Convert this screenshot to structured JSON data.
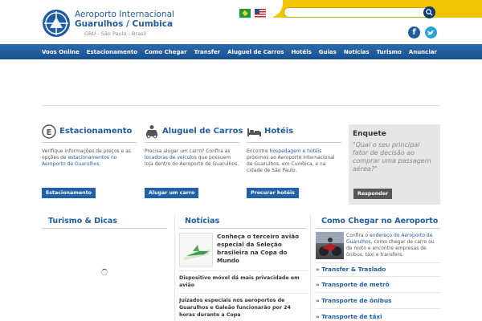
{
  "header": {
    "logo_line1": "Aeroporto Internacional",
    "logo_line2": "Guarulhos / Cumbica",
    "logo_line3": "GRU - São Paulo - Brasil",
    "search_placeholder": "",
    "accent_yellow": "#f1c400",
    "brand_blue": "#1f5da3"
  },
  "nav": {
    "items": [
      "Voos Online",
      "Estacionamento",
      "Como Chegar",
      "Transfer",
      "Aluguel de Carros",
      "Hotéis",
      "Guias",
      "Notícias",
      "Turismo",
      "Anunciar"
    ]
  },
  "features": [
    {
      "title": "Estacionamento",
      "icon": "parking-icon",
      "text_a": "Verifique informações de preços e as opções de ",
      "text_link": "estacionamentos no Aeroporto de Guarulhos",
      "text_b": ".",
      "button": "Estacionamento"
    },
    {
      "title": "Aluguel de Carros",
      "icon": "car-icon",
      "text_a": "Precisa alugar um carro? Confira as ",
      "text_link": "locadoras de veículos",
      "text_b": " que possuem loja dentro do Aeroporto de Guarulhos.",
      "button": "Alugar um carro"
    },
    {
      "title": "Hotéis",
      "icon": "bed-icon",
      "text_a": "Encontre ",
      "text_link": "hospedagem e hotéis",
      "text_b": " próximos ao Aeroporto Internacional de Guarulhos, em Cumbica, e na cidade de São Paulo.",
      "button": "Procurar hotéis"
    }
  ],
  "poll": {
    "title": "Enquete",
    "question": "\"Qual o seu principal fator de decisão ao comprar uma passagem aérea?\"",
    "button": "Responder"
  },
  "turismo": {
    "title": "Turismo & Dicas"
  },
  "noticias": {
    "title": "Notícias",
    "main": "Conheça o terceiro avião especial da Seleção brasileira na Copa do Mundo",
    "items": [
      "Dispositivo móvel dá mais privacidade em avião",
      "Juizados especiais nos aeroportos de Guarulhos e Galeão funcionarão por 24 horas durante a Copa"
    ]
  },
  "como_chegar": {
    "title": "Como Chegar no Aeroporto",
    "text_a": "Confira o ",
    "text_link": "endereço do Aeroporto de Guarulhos",
    "text_b": ", como chegar de carro ou de moto e encontre empresas de ônibus, táxi e transfers.",
    "links": [
      "» Transfer & Traslado",
      "» Transporte de metrô",
      "» Transporte de ônibus",
      "» Transporte de táxi"
    ]
  }
}
